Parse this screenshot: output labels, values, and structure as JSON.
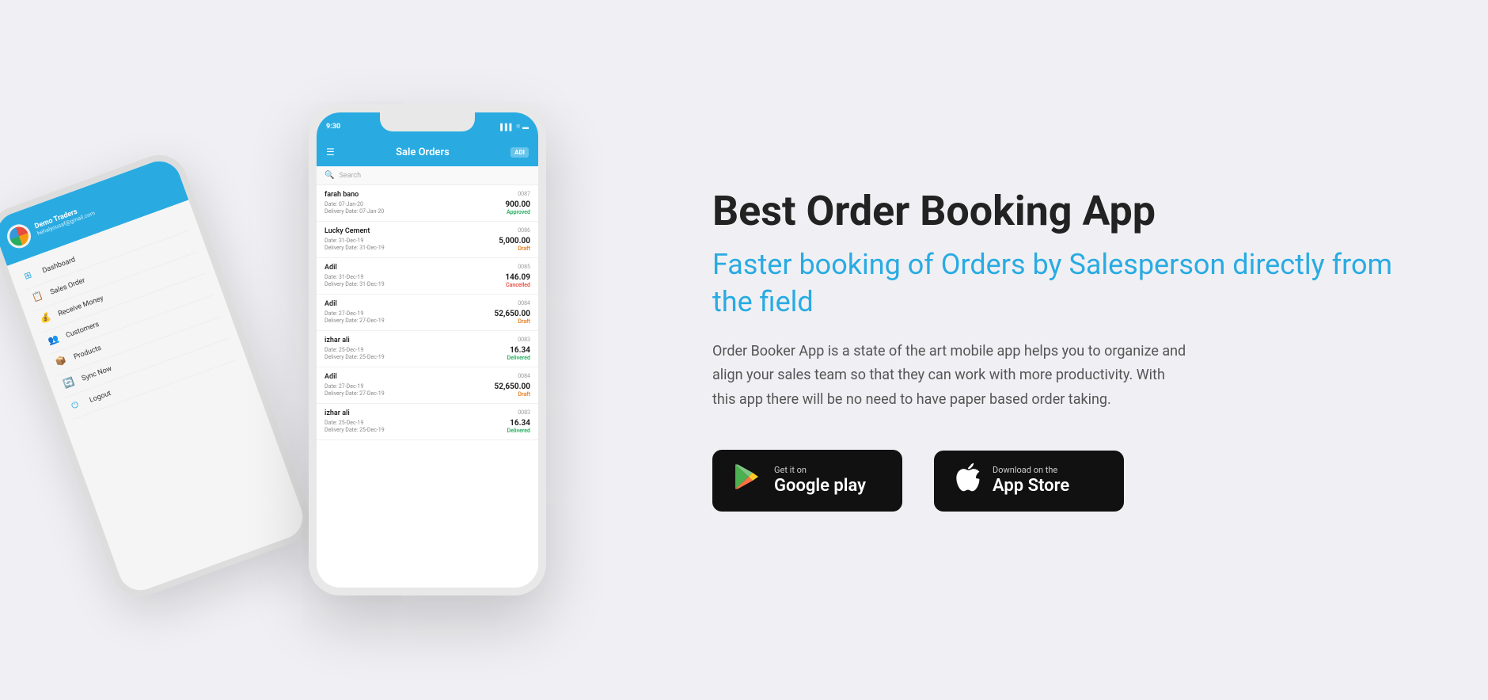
{
  "page": {
    "background_color": "#f0f0f4"
  },
  "phone_back": {
    "user": {
      "company": "Demo Traders",
      "email": "hehalyousaf@gmail.com"
    },
    "menu_items": [
      {
        "icon": "⊞",
        "label": "Dashboard"
      },
      {
        "icon": "📋",
        "label": "Sales Order"
      },
      {
        "icon": "💰",
        "label": "Receive Money"
      },
      {
        "icon": "👥",
        "label": "Customers"
      },
      {
        "icon": "📦",
        "label": "Products"
      },
      {
        "icon": "🔄",
        "label": "Sync Now"
      },
      {
        "icon": "⏻",
        "label": "Logout"
      }
    ]
  },
  "phone_front": {
    "status_bar": {
      "time": "9:30",
      "icons": "▌▌▌ ⓦ ▬"
    },
    "header": {
      "title": "Sale Orders",
      "menu_icon": "☰",
      "user_badge": "ADI"
    },
    "search": {
      "placeholder": "Search"
    },
    "orders": [
      {
        "name": "farah bano",
        "number": "0087",
        "amount": "900.00",
        "date_label": "Date:",
        "date": "07-Jan-20",
        "delivery_label": "Delivery Date:",
        "delivery": "07-Jan-20",
        "status": "Approved",
        "status_class": "approved"
      },
      {
        "name": "Lucky Cement",
        "number": "0086",
        "amount": "5,000.00",
        "date_label": "Date:",
        "date": "31-Dec-19",
        "delivery_label": "Delivery Date:",
        "delivery": "31-Dec-19",
        "status": "Draft",
        "status_class": "draft"
      },
      {
        "name": "Adil",
        "number": "0085",
        "amount": "146.09",
        "date_label": "Date:",
        "date": "31-Dec-19",
        "delivery_label": "Delivery Date:",
        "delivery": "31-Dec-19",
        "status": "Cancelled",
        "status_class": "cancelled"
      },
      {
        "name": "Adil",
        "number": "0084",
        "amount": "52,650.00",
        "date_label": "Date:",
        "date": "27-Dec-19",
        "delivery_label": "Delivery Date:",
        "delivery": "27-Dec-19",
        "status": "Draft",
        "status_class": "draft"
      },
      {
        "name": "izhar ali",
        "number": "0083",
        "amount": "16.34",
        "date_label": "Date:",
        "date": "25-Dec-19",
        "delivery_label": "Delivery Date:",
        "delivery": "25-Dec-19",
        "status": "Delivered",
        "status_class": "delivered"
      },
      {
        "name": "Adil",
        "number": "0084",
        "amount": "52,650.00",
        "date_label": "Date:",
        "date": "27-Dec-19",
        "delivery_label": "Delivery Date:",
        "delivery": "27-Dec-19",
        "status": "Draft",
        "status_class": "draft"
      },
      {
        "name": "izhar ali",
        "number": "0083",
        "amount": "16.34",
        "date_label": "Date:",
        "date": "25-Dec-19",
        "delivery_label": "Delivery Date:",
        "delivery": "25-Dec-19",
        "status": "Delivered",
        "status_class": "delivered"
      }
    ]
  },
  "content": {
    "main_title": "Best Order Booking App",
    "sub_title": "Faster booking of Orders by Salesperson directly from the field",
    "description": "Order Booker App is a state of the art mobile app helps you to organize and align your sales team so that they can work with more productivity. With this app there will be no need to have paper based order taking.",
    "google_play": {
      "small_text": "Get it on",
      "large_text": "Google play",
      "icon": "▶"
    },
    "app_store": {
      "small_text": "Download on the",
      "large_text": "App Store",
      "icon": ""
    }
  }
}
